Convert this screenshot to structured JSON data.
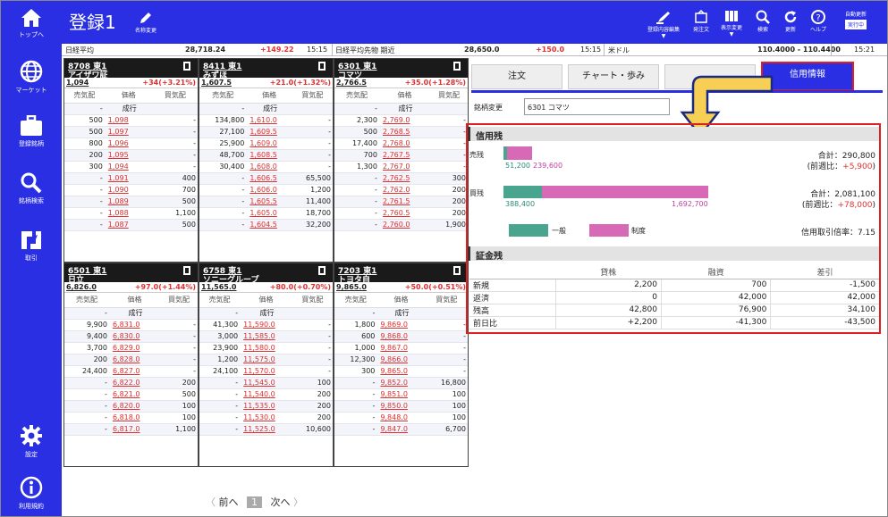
{
  "sidebar": {
    "items": [
      {
        "label": "トップへ",
        "icon": "home-icon"
      },
      {
        "label": "マーケット",
        "icon": "globe-icon"
      },
      {
        "label": "登録銘柄",
        "icon": "briefcase-icon"
      },
      {
        "label": "銘柄検索",
        "icon": "search-icon"
      },
      {
        "label": "取引",
        "icon": "trade-icon"
      },
      {
        "label": "設定",
        "icon": "gear-icon"
      },
      {
        "label": "利用規約",
        "icon": "info-icon"
      }
    ]
  },
  "header": {
    "title": "登録1",
    "edit_name": "名称変更",
    "buttons": [
      "登録内容編集",
      "発注文",
      "表示変更",
      "検索",
      "更新",
      "ヘルプ"
    ],
    "auto_update": "自動更新",
    "auto_update_state": "実行中"
  },
  "ticker": {
    "nikkei_label": "日経平均",
    "nikkei_value": "28,718.24",
    "nikkei_change": "+149.22",
    "nikkei_time": "15:15",
    "futures_label": "日経平均先物 期近",
    "futures_value": "28,650.0",
    "futures_change": "+150.0",
    "futures_time": "15:15",
    "usd_label": "米ドル",
    "usd_value": "110.4000 - 110.4400",
    "usd_time": "15:21"
  },
  "table_headers": {
    "sell": "売気配",
    "price": "価格",
    "buy": "買気配"
  },
  "panels": [
    {
      "code": "8708 東1",
      "name": "アイザワ証",
      "price": "1,094",
      "change": "+34(+3.21%)",
      "rows": [
        [
          "-",
          "成行",
          ""
        ],
        [
          "500",
          "1,098",
          "-"
        ],
        [
          "500",
          "1,097",
          "-"
        ],
        [
          "800",
          "1,096",
          "-"
        ],
        [
          "200",
          "1,095",
          "-"
        ],
        [
          "300",
          "1,094",
          "-"
        ],
        [
          "-",
          "1,091",
          "400"
        ],
        [
          "-",
          "1,090",
          "700"
        ],
        [
          "-",
          "1,089",
          "500"
        ],
        [
          "-",
          "1,088",
          "1,100"
        ],
        [
          "-",
          "1,087",
          "500"
        ]
      ]
    },
    {
      "code": "8411 東1",
      "name": "みずほ",
      "price": "1,607.5",
      "change": "+21.0(+1.32%)",
      "rows": [
        [
          "-",
          "成行",
          ""
        ],
        [
          "134,800",
          "1,610.0",
          "-"
        ],
        [
          "27,100",
          "1,609.5",
          "-"
        ],
        [
          "25,900",
          "1,609.0",
          "-"
        ],
        [
          "48,700",
          "1,608.5",
          "-"
        ],
        [
          "30,400",
          "1,608.0",
          "-"
        ],
        [
          "-",
          "1,606.5",
          "65,500"
        ],
        [
          "-",
          "1,606.0",
          "1,200"
        ],
        [
          "-",
          "1,605.5",
          "11,400"
        ],
        [
          "-",
          "1,605.0",
          "18,700"
        ],
        [
          "-",
          "1,604.5",
          "32,200"
        ]
      ]
    },
    {
      "code": "6301 東1",
      "name": "コマツ",
      "price": "2,766.5",
      "change": "+35.0(+1.28%)",
      "rows": [
        [
          "-",
          "成行",
          ""
        ],
        [
          "2,300",
          "2,769.0",
          "-"
        ],
        [
          "500",
          "2,768.5",
          "-"
        ],
        [
          "17,400",
          "2,768.0",
          "-"
        ],
        [
          "700",
          "2,767.5",
          "-"
        ],
        [
          "1,300",
          "2,767.0",
          "-"
        ],
        [
          "-",
          "2,762.5",
          "300"
        ],
        [
          "-",
          "2,762.0",
          "200"
        ],
        [
          "-",
          "2,761.5",
          "200"
        ],
        [
          "-",
          "2,760.5",
          "200"
        ],
        [
          "-",
          "2,760.0",
          "1,900"
        ]
      ]
    },
    {
      "code": "6501 東1",
      "name": "日立",
      "price": "6,826.0",
      "change": "+97.0(+1.44%)",
      "rows": [
        [
          "-",
          "成行",
          ""
        ],
        [
          "9,900",
          "6,831.0",
          "-"
        ],
        [
          "9,400",
          "6,830.0",
          "-"
        ],
        [
          "3,700",
          "6,829.0",
          "-"
        ],
        [
          "200",
          "6,828.0",
          "-"
        ],
        [
          "24,400",
          "6,827.0",
          "-"
        ],
        [
          "-",
          "6,822.0",
          "200"
        ],
        [
          "-",
          "6,821.0",
          "500"
        ],
        [
          "-",
          "6,820.0",
          "100"
        ],
        [
          "-",
          "6,818.0",
          "100"
        ],
        [
          "-",
          "6,817.0",
          "1,100"
        ]
      ]
    },
    {
      "code": "6758 東1",
      "name": "ソニーグループ",
      "price": "11,565.0",
      "change": "+80.0(+0.70%)",
      "rows": [
        [
          "-",
          "成行",
          ""
        ],
        [
          "41,300",
          "11,590.0",
          "-"
        ],
        [
          "3,000",
          "11,585.0",
          "-"
        ],
        [
          "23,900",
          "11,580.0",
          "-"
        ],
        [
          "1,200",
          "11,575.0",
          "-"
        ],
        [
          "24,100",
          "11,570.0",
          "-"
        ],
        [
          "-",
          "11,545.0",
          "100"
        ],
        [
          "-",
          "11,540.0",
          "200"
        ],
        [
          "-",
          "11,535.0",
          "200"
        ],
        [
          "-",
          "11,530.0",
          "200"
        ],
        [
          "-",
          "11,525.0",
          "10,600"
        ]
      ]
    },
    {
      "code": "7203 東1",
      "name": "トヨタ自",
      "price": "9,865.0",
      "change": "+50.0(+0.51%)",
      "rows": [
        [
          "-",
          "成行",
          ""
        ],
        [
          "1,800",
          "9,869.0",
          "-"
        ],
        [
          "600",
          "9,868.0",
          "-"
        ],
        [
          "1,000",
          "9,867.0",
          "-"
        ],
        [
          "12,300",
          "9,866.0",
          "-"
        ],
        [
          "300",
          "9,865.0",
          "-"
        ],
        [
          "-",
          "9,852.0",
          "16,800"
        ],
        [
          "-",
          "9,851.0",
          "100"
        ],
        [
          "-",
          "9,850.0",
          "100"
        ],
        [
          "-",
          "9,848.0",
          "100"
        ],
        [
          "-",
          "9,847.0",
          "6,700"
        ]
      ]
    }
  ],
  "pager": {
    "prev": "前へ",
    "page": "1",
    "next": "次へ"
  },
  "right": {
    "tabs": [
      "注文",
      "チャート・歩み",
      "",
      "信用情報"
    ],
    "symbol_label": "銘柄変更",
    "symbol_value": "6301 コマツ",
    "credit": {
      "title": "信用残",
      "sell_label": "売残",
      "sell_general": "51,200",
      "sell_system": "239,600",
      "sell_total": "合計：290,800",
      "sell_prev_prefix": "(前週比：",
      "sell_prev_value": "+5,900",
      "sell_prev_suffix": ")",
      "buy_label": "買残",
      "buy_general": "388,400",
      "buy_system": "1,692,700",
      "buy_total": "合計：2,081,100",
      "buy_prev_prefix": "(前週比：",
      "buy_prev_value": "+78,000",
      "buy_prev_suffix": ")",
      "legend_general": "一般",
      "legend_system": "制度",
      "ratio": "信用取引倍率：7.15",
      "colors": {
        "general": "#4aa58f",
        "system": "#d769b6"
      }
    },
    "lending": {
      "title": "証金残",
      "headers": [
        "",
        "貸株",
        "融資",
        "差引"
      ],
      "rows": [
        [
          "新規",
          "2,200",
          "700",
          "-1,500"
        ],
        [
          "返済",
          "0",
          "42,000",
          "42,000"
        ],
        [
          "残高",
          "42,800",
          "76,900",
          "34,100"
        ],
        [
          "前日比",
          "+2,200",
          "-41,300",
          "-43,500"
        ]
      ]
    }
  }
}
